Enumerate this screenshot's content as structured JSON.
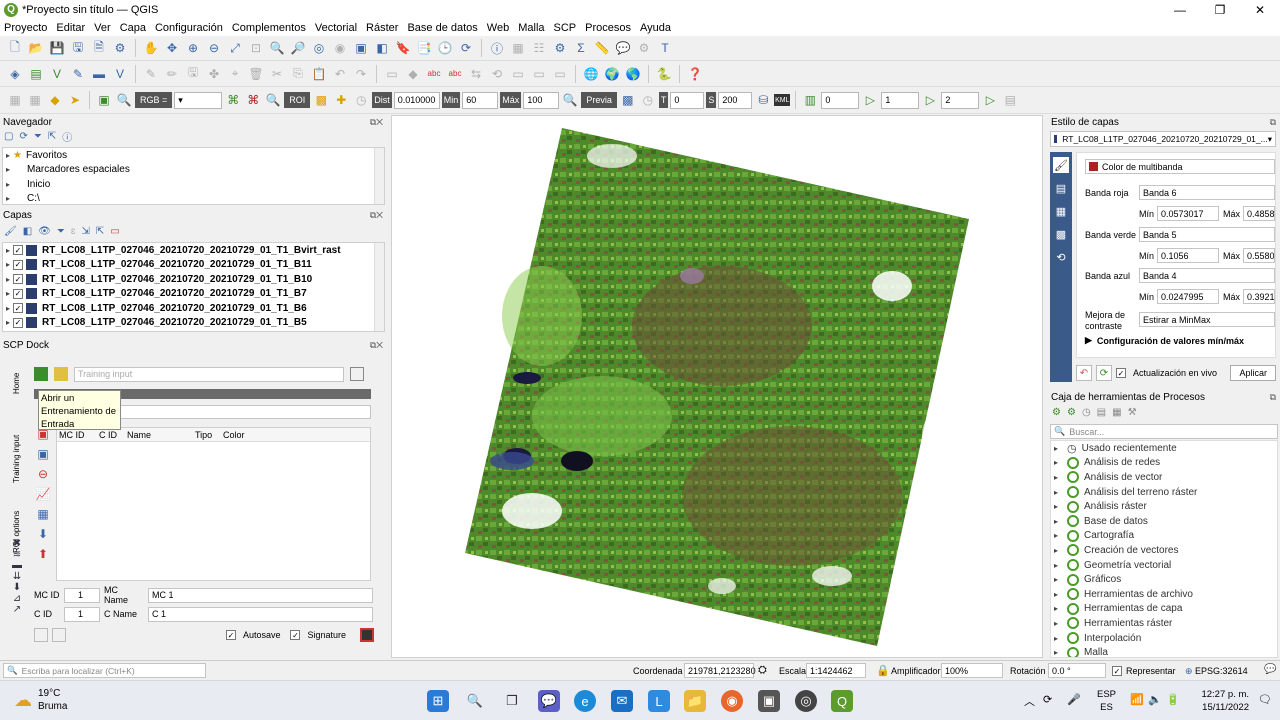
{
  "window": {
    "title": "*Proyecto sin título — QGIS",
    "logo": "Q"
  },
  "menu": [
    "Proyecto",
    "Editar",
    "Ver",
    "Capa",
    "Configuración",
    "Complementos",
    "Vectorial",
    "Ráster",
    "Base de datos",
    "Web",
    "Malla",
    "SCP",
    "Procesos",
    "Ayuda"
  ],
  "scp_toolbar": {
    "rgb_label": "RGB =",
    "roi_label": "ROI",
    "dist_label": "Dist",
    "dist_value": "0.010000",
    "min_label": "Min",
    "min_value": "60",
    "max_label": "Máx",
    "max_value": "100",
    "previa_label": "Previa",
    "t_value": "0",
    "s_value": "200",
    "kml_label": "KML",
    "b1_value": "0",
    "b2_value": "1",
    "b3_value": "2"
  },
  "navigator": {
    "title": "Navegador",
    "items": [
      "Favoritos",
      "Marcadores espaciales",
      "Inicio",
      "C:\\"
    ]
  },
  "layers": {
    "title": "Capas",
    "items": [
      "RT_LC08_L1TP_027046_20210720_20210729_01_T1_Bvirt_rast",
      "RT_LC08_L1TP_027046_20210720_20210729_01_T1_B11",
      "RT_LC08_L1TP_027046_20210720_20210729_01_T1_B10",
      "RT_LC08_L1TP_027046_20210720_20210729_01_T1_B7",
      "RT_LC08_L1TP_027046_20210720_20210729_01_T1_B6",
      "RT_LC08_L1TP_027046_20210720_20210729_01_T1_B5"
    ]
  },
  "scp_dock": {
    "title": "SCP Dock",
    "side_tabs": [
      "Home",
      "Training input",
      "ROI options"
    ],
    "training_input_placeholder": "Training input",
    "tooltip": "Abrir un Entrenamiento de Entrada",
    "columns": [
      "MC ID",
      "C ID",
      "Name",
      "Tipo",
      "Color"
    ],
    "mc_id_label": "MC ID",
    "mc_id_value": "1",
    "mc_name_label": "MC Name",
    "mc_name_value": "MC 1",
    "c_id_label": "C ID",
    "c_id_value": "1",
    "c_name_label": "C Name",
    "c_name_value": "C 1",
    "autosave_label": "Autosave",
    "signature_label": "Signature"
  },
  "layer_style": {
    "title": "Estilo de capas",
    "layer_select": "RT_LC08_L1TP_027046_20210720_20210729_01_...",
    "renderer": "Color de multibanda",
    "red_label": "Banda roja",
    "red_band": "Banda 6",
    "red_min": "0.0573017",
    "red_max": "0.4858",
    "green_label": "Banda verde",
    "green_band": "Banda 5",
    "green_min": "0.1056",
    "green_max": "0.5580",
    "blue_label": "Banda azul",
    "blue_band": "Banda 4",
    "blue_min": "0.0247995",
    "blue_max": "0.3921",
    "min_label": "Mín",
    "max_label": "Máx",
    "contrast_label": "Mejora de contraste",
    "contrast_value": "Estirar a MinMax",
    "minmax_section": "Configuración de valores mín/máx",
    "live_update": "Actualización en vivo",
    "apply": "Aplicar"
  },
  "processing": {
    "title": "Caja de herramientas de Procesos",
    "search_placeholder": "Buscar...",
    "items": [
      "Usado recientemente",
      "Análisis de redes",
      "Análisis de vector",
      "Análisis del terreno ráster",
      "Análisis ráster",
      "Base de datos",
      "Cartografía",
      "Creación de vectores",
      "Geometría vectorial",
      "Gráficos",
      "Herramientas de archivo",
      "Herramientas de capa",
      "Herramientas ráster",
      "Interpolación",
      "Malla"
    ]
  },
  "status": {
    "locator_placeholder": "Escriba para localizar (Ctrl+K)",
    "coord_label": "Coordenada",
    "coord_value": "219781,2123280",
    "scale_label": "Escala",
    "scale_value": "1:1424462",
    "magnifier_label": "Amplificador",
    "magnifier_value": "100%",
    "rotation_label": "Rotación",
    "rotation_value": "0.0 °",
    "render_label": "Representar",
    "crs": "EPSG:32614"
  },
  "taskbar": {
    "weather_temp": "19°C",
    "weather_desc": "Bruma",
    "lang1": "ESP",
    "lang2": "ES",
    "time": "12:27 p. m.",
    "date": "15/11/2022"
  },
  "colors": {
    "qgis_green": "#5b9c2c",
    "accent_blue": "#3a66a8"
  }
}
